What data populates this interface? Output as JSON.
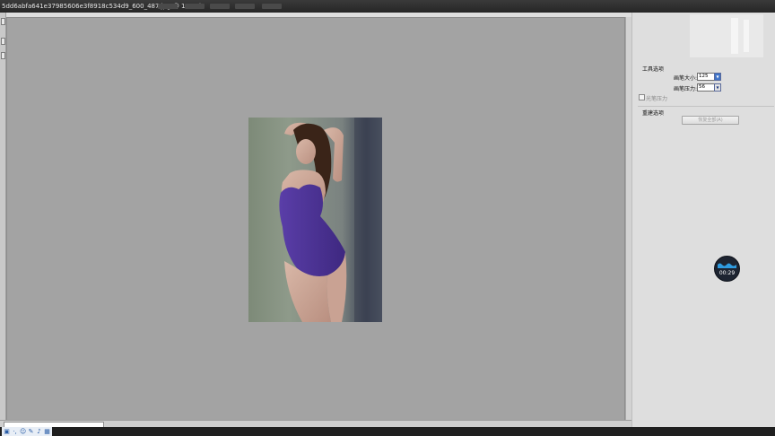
{
  "window": {
    "title": "5dd6abfa641e37985606e3f8918c534d9_600_487.jpg @ 100%)"
  },
  "tool_options": {
    "section_title": "工具选项",
    "brush_size_label": "画笔大小:",
    "brush_size_value": "125",
    "brush_pressure_label": "画笔压力:",
    "brush_pressure_value": "56",
    "pen_pressure_label": "光笔压力"
  },
  "reconstruct_options": {
    "section_title": "重建选项",
    "restore_all_label": "恢复全部(A)"
  },
  "recording_timer": {
    "time": "00:29"
  },
  "colors": {
    "canvas_bg": "#a3a3a3",
    "panel_bg": "#dedede",
    "title_bar": "#262626",
    "spin_active": "#3f73c8",
    "timer_wave": "#2f9be0"
  },
  "icons": {
    "photo_subject": "woman-in-purple-swimsuit"
  }
}
